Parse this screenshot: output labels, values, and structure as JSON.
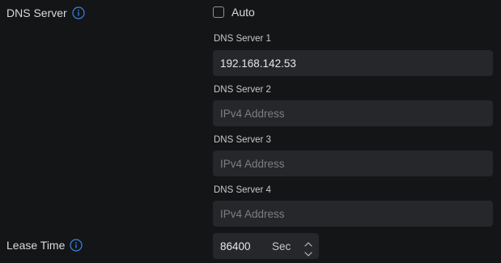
{
  "dns": {
    "label": "DNS Server",
    "auto_label": "Auto",
    "auto_checked": false,
    "servers": [
      {
        "label": "DNS Server 1",
        "value": "192.168.142.53",
        "placeholder": "IPv4 Address"
      },
      {
        "label": "DNS Server 2",
        "value": "",
        "placeholder": "IPv4 Address"
      },
      {
        "label": "DNS Server 3",
        "value": "",
        "placeholder": "IPv4 Address"
      },
      {
        "label": "DNS Server 4",
        "value": "",
        "placeholder": "IPv4 Address"
      }
    ]
  },
  "lease": {
    "label": "Lease Time",
    "value": "86400",
    "unit": "Sec"
  },
  "colors": {
    "background": "#141517",
    "field_background": "#25272a",
    "info_icon": "#3b82e6"
  },
  "icons": {
    "info": "info-circle-icon",
    "checkbox": "checkbox-unchecked-icon",
    "stepper_up": "chevron-up-icon",
    "stepper_down": "chevron-down-icon"
  }
}
